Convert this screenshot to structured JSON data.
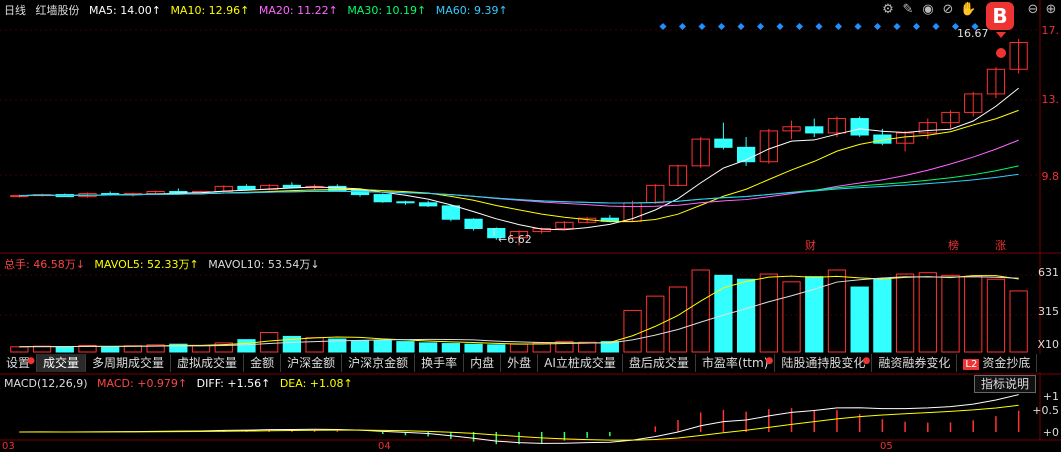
{
  "header": {
    "period": "日线",
    "stock_name": "红墙股份",
    "ma": [
      {
        "label": "MA5: 14.00↑",
        "color": "#ffffff"
      },
      {
        "label": "MA10: 12.96↑",
        "color": "#ffff00"
      },
      {
        "label": "MA20: 11.22↑",
        "color": "#ff66ff"
      },
      {
        "label": "MA30: 10.19↑",
        "color": "#00ff66"
      },
      {
        "label": "MA60: 9.39↑",
        "color": "#33ccff"
      }
    ]
  },
  "price_axis": [
    "17.",
    "13.",
    "9.8"
  ],
  "annotations": {
    "high": "16.67",
    "low": "6.62",
    "tag_cai": "财",
    "tag_bang": "榜",
    "tag_zhang": "涨"
  },
  "volume": {
    "legend": [
      {
        "label": "总手: 46.58万↓",
        "color": "#ff4444"
      },
      {
        "label": "MAVOL5: 52.33万↑",
        "color": "#ffff00"
      },
      {
        "label": "MAVOL10: 53.54万↓",
        "color": "#dddddd"
      }
    ],
    "axis": [
      "631",
      "315",
      "X10"
    ]
  },
  "tabs": [
    {
      "label": "设置",
      "dot": true
    },
    {
      "label": "成交量",
      "active": true
    },
    {
      "label": "多周期成交量"
    },
    {
      "label": "虚拟成交量"
    },
    {
      "label": "金额"
    },
    {
      "label": "沪深金额"
    },
    {
      "label": "沪深京金额"
    },
    {
      "label": "换手率"
    },
    {
      "label": "内盘"
    },
    {
      "label": "外盘"
    },
    {
      "label": "AI立桩成交量"
    },
    {
      "label": "盘后成交量"
    },
    {
      "label": "市盈率(ttm)",
      "dot": true
    },
    {
      "label": "陆股通持股变化",
      "dot": true
    },
    {
      "label": "融资融券变化"
    },
    {
      "label": "资金抄底",
      "badge": "L2"
    }
  ],
  "macd": {
    "legend": [
      {
        "label": "MACD(12,26,9)",
        "color": "#dddddd"
      },
      {
        "label": "MACD: +0.979↑",
        "color": "#ff4444"
      },
      {
        "label": "DIFF: +1.56↑",
        "color": "#ffffff"
      },
      {
        "label": "DEA: +1.08↑",
        "color": "#ffff00"
      }
    ],
    "help_button": "指标说明",
    "axis": [
      "+1",
      "+0.5",
      "+0"
    ]
  },
  "date_axis": [
    "03",
    "04",
    "05"
  ],
  "toolbar_icons": [
    "gear-icon",
    "brush-icon",
    "eye-icon",
    "eye-off-icon",
    "hand-icon",
    "layers-icon",
    "minus-icon",
    "add-icon"
  ],
  "brand_badge": "B",
  "chart_data": {
    "type": "candlestick",
    "candles": [
      [
        9.0,
        9.1,
        8.95,
        9.05
      ],
      [
        9.05,
        9.15,
        9.0,
        9.1
      ],
      [
        9.1,
        9.15,
        9.0,
        9.0
      ],
      [
        9.0,
        9.2,
        8.95,
        9.15
      ],
      [
        9.15,
        9.25,
        9.05,
        9.1
      ],
      [
        9.1,
        9.2,
        9.0,
        9.15
      ],
      [
        9.15,
        9.3,
        9.1,
        9.25
      ],
      [
        9.25,
        9.4,
        9.15,
        9.2
      ],
      [
        9.2,
        9.3,
        9.1,
        9.25
      ],
      [
        9.25,
        9.55,
        9.2,
        9.5
      ],
      [
        9.5,
        9.6,
        9.3,
        9.35
      ],
      [
        9.35,
        9.6,
        9.3,
        9.55
      ],
      [
        9.55,
        9.7,
        9.4,
        9.45
      ],
      [
        9.45,
        9.6,
        9.35,
        9.5
      ],
      [
        9.5,
        9.6,
        9.3,
        9.3
      ],
      [
        9.3,
        9.4,
        9.0,
        9.1
      ],
      [
        9.1,
        9.15,
        8.7,
        8.75
      ],
      [
        8.75,
        8.8,
        8.6,
        8.7
      ],
      [
        8.7,
        8.8,
        8.5,
        8.55
      ],
      [
        8.55,
        8.6,
        7.8,
        7.9
      ],
      [
        7.9,
        7.95,
        7.35,
        7.45
      ],
      [
        7.45,
        7.5,
        6.9,
        7.0
      ],
      [
        7.0,
        7.35,
        6.62,
        7.3
      ],
      [
        7.3,
        7.5,
        7.2,
        7.45
      ],
      [
        7.45,
        7.8,
        7.4,
        7.75
      ],
      [
        7.75,
        8.0,
        7.7,
        7.95
      ],
      [
        7.95,
        8.1,
        7.75,
        7.8
      ],
      [
        7.8,
        8.8,
        7.8,
        8.7
      ],
      [
        8.7,
        9.6,
        8.65,
        9.55
      ],
      [
        9.55,
        10.55,
        9.5,
        10.5
      ],
      [
        10.5,
        11.9,
        10.4,
        11.8
      ],
      [
        11.8,
        12.6,
        11.3,
        11.4
      ],
      [
        11.4,
        11.9,
        10.5,
        10.7
      ],
      [
        10.7,
        12.3,
        10.6,
        12.2
      ],
      [
        12.2,
        12.7,
        11.8,
        12.4
      ],
      [
        12.4,
        12.8,
        11.9,
        12.1
      ],
      [
        12.1,
        12.9,
        11.9,
        12.8
      ],
      [
        12.8,
        12.9,
        11.9,
        12.0
      ],
      [
        12.0,
        12.3,
        11.5,
        11.6
      ],
      [
        11.6,
        12.2,
        11.2,
        12.1
      ],
      [
        12.1,
        12.8,
        11.8,
        12.6
      ],
      [
        12.6,
        13.2,
        12.3,
        13.1
      ],
      [
        13.1,
        14.1,
        12.9,
        14.0
      ],
      [
        14.0,
        15.3,
        13.8,
        15.2
      ],
      [
        15.2,
        16.67,
        15.0,
        16.5
      ]
    ],
    "volume": [
      40,
      45,
      38,
      50,
      42,
      48,
      55,
      60,
      50,
      70,
      95,
      150,
      120,
      110,
      100,
      85,
      90,
      80,
      70,
      65,
      60,
      55,
      60,
      70,
      80,
      75,
      80,
      320,
      430,
      500,
      631,
      590,
      560,
      600,
      540,
      580,
      631,
      500,
      560,
      600,
      610,
      590,
      580,
      560,
      470
    ],
    "price_range": [
      6.5,
      17.5
    ]
  }
}
